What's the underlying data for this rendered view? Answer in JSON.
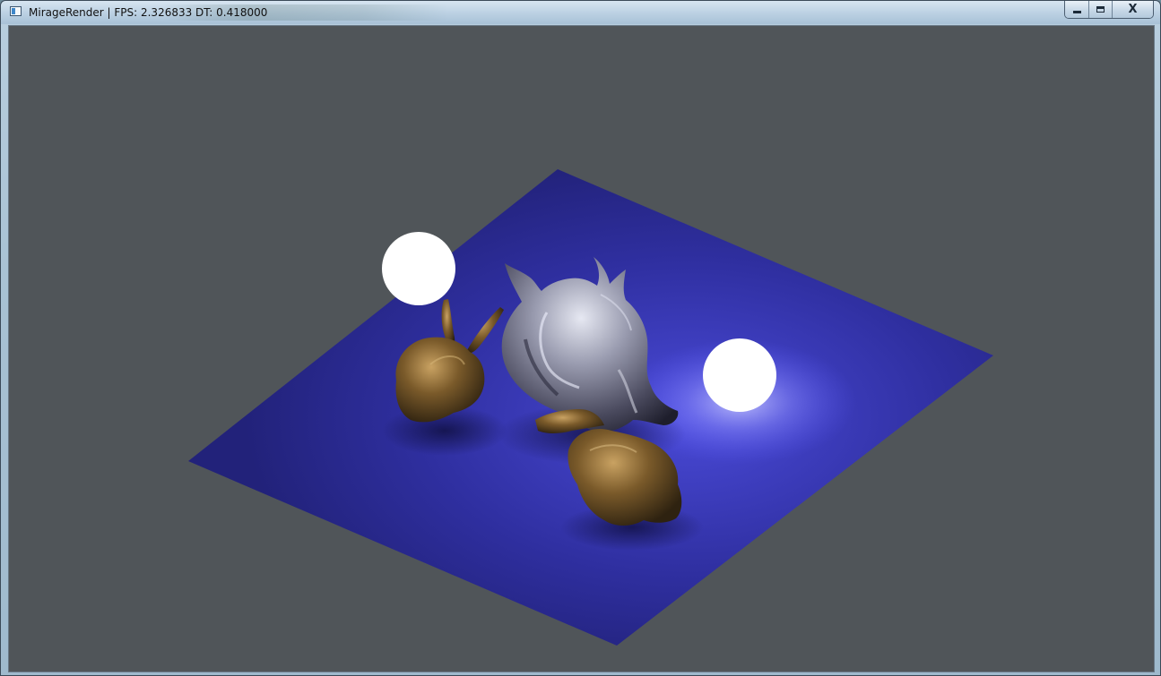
{
  "window": {
    "title": "MirageRender | FPS: 2.326833 DT: 0.418000",
    "controls": {
      "minimize_icon": "minimize-icon",
      "maximize_icon": "maximize-icon",
      "close_icon": "close-icon",
      "close_glyph": "X"
    }
  },
  "scene": {
    "background_color": "#505559",
    "plane_color": "#2f2f9c",
    "objects": [
      "bunny-gold",
      "dragon-silver",
      "bunny-gold",
      "light-sphere",
      "light-sphere"
    ]
  }
}
